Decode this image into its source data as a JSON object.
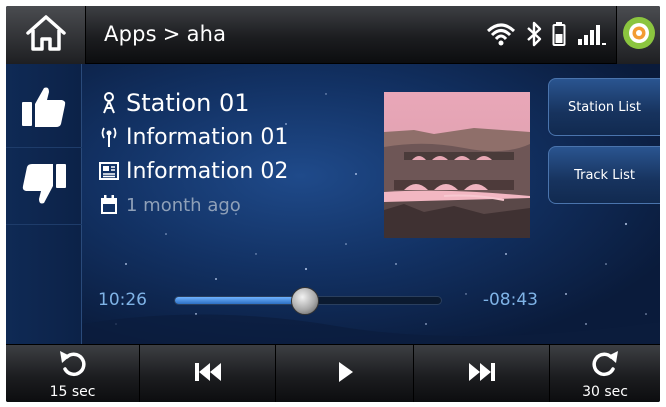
{
  "topbar": {
    "breadcrumb": {
      "parent": "Apps",
      "separator": ">",
      "current": "aha"
    },
    "status_icons": [
      "wifi-icon",
      "bluetooth-icon",
      "battery-icon",
      "signal-icon"
    ]
  },
  "sidebar": {
    "like_icon": "thumbs-up-icon",
    "dislike_icon": "thumbs-down-icon"
  },
  "now_playing": {
    "station": "Station 01",
    "info1": "Information 01",
    "info2": "Information 02",
    "age": "1 month ago"
  },
  "right_buttons": {
    "station_list": "Station List",
    "track_list": "Track List"
  },
  "progress": {
    "elapsed": "10:26",
    "remaining": "-08:43",
    "fraction": 0.49
  },
  "controls": {
    "skip_back_label": "15 sec",
    "skip_forward_label": "30 sec"
  },
  "colors": {
    "accent_blue": "#6fb2ff",
    "time_text": "#7fb3e6",
    "background": "#123163",
    "app_logo_green": "#8bc53f",
    "app_logo_orange": "#f39c32"
  }
}
